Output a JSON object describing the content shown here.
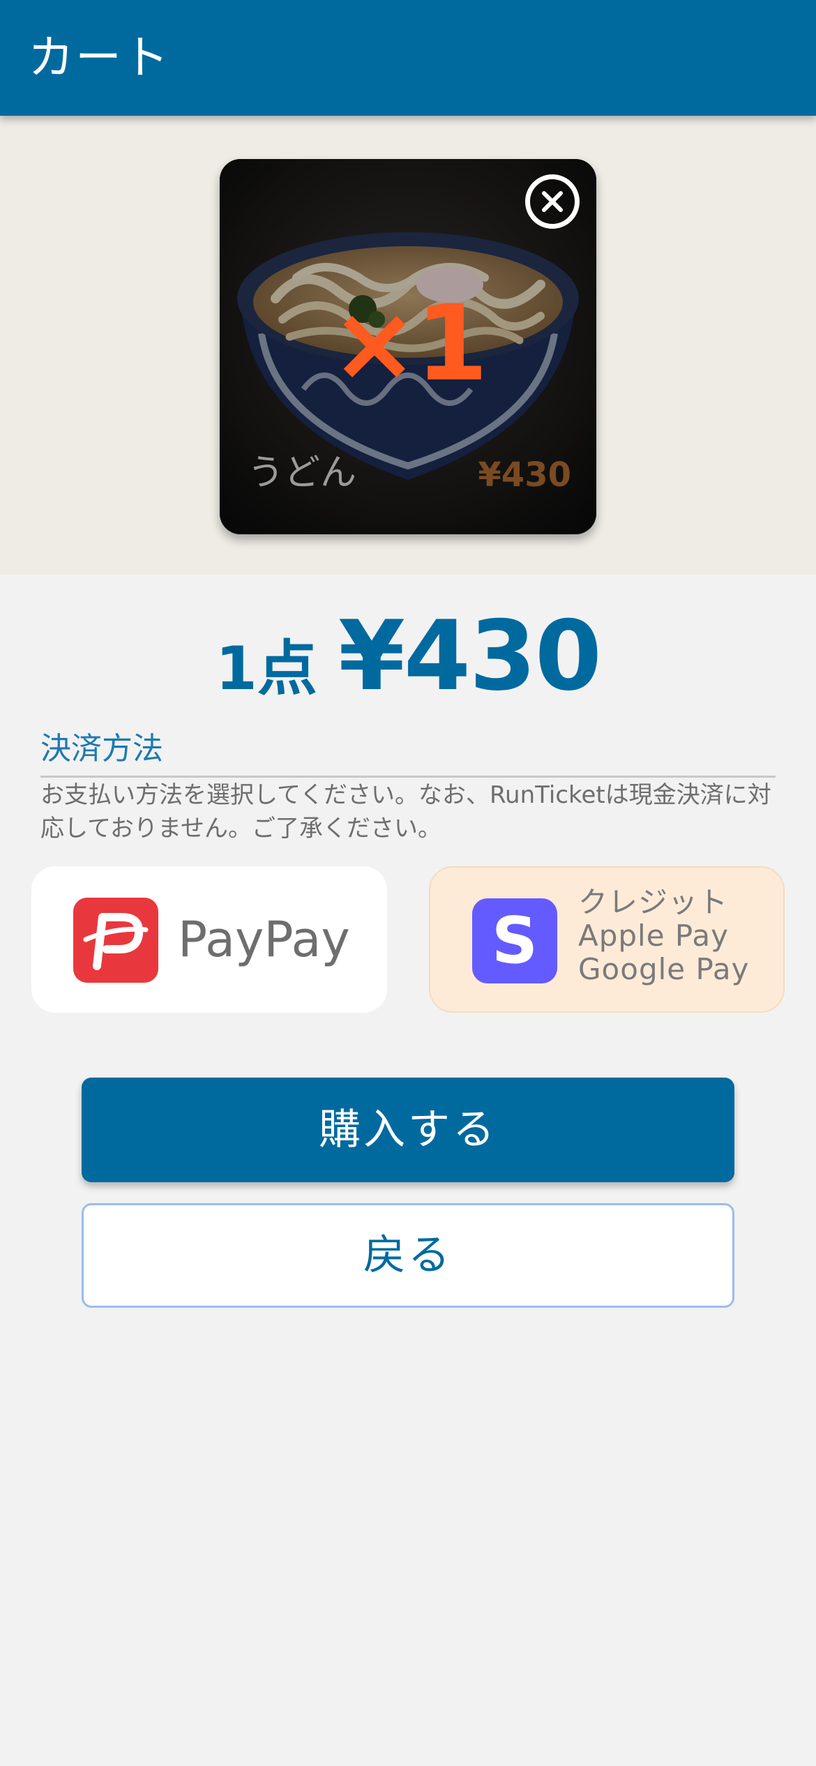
{
  "header": {
    "title": "カート"
  },
  "cart": {
    "items": [
      {
        "name": "うどん",
        "price": "¥430",
        "quantity": "×1",
        "remove_icon": "close-circle-icon"
      }
    ]
  },
  "summary": {
    "count": "1点",
    "total": "¥430"
  },
  "payment": {
    "section_title": "決済方法",
    "description": "お支払い方法を選択してください。なお、RunTicketは現金決済に対応しておりません。ご了承ください。",
    "options": [
      {
        "label": "PayPay",
        "icon": "paypay-logo-icon"
      },
      {
        "lines": [
          "クレジット",
          "Apple Pay",
          "Google Pay"
        ],
        "icon": "stripe-logo-icon",
        "icon_text": "S"
      }
    ]
  },
  "actions": {
    "buy_label": "購入する",
    "back_label": "戻る"
  },
  "colors": {
    "primary": "#006a9f",
    "accent": "#ff5a1f",
    "cart_background": "#efebe5",
    "selected_option": "#fdebd8",
    "paypay_red": "#e8383d",
    "stripe_purple": "#635bff"
  }
}
